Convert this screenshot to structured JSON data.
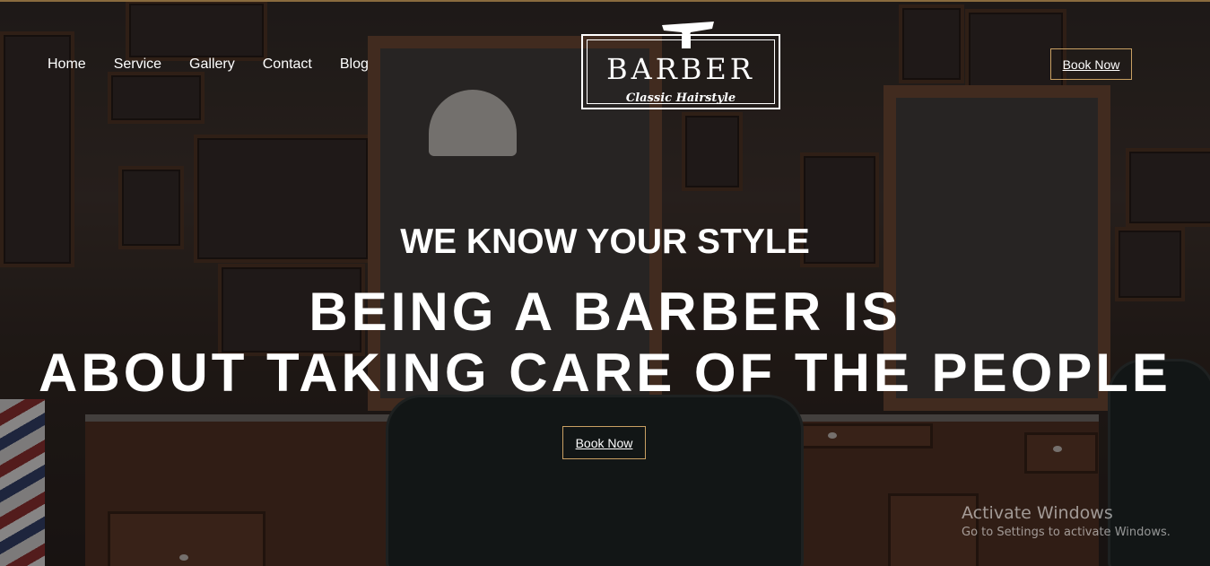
{
  "nav": {
    "items": [
      "Home",
      "Service",
      "Gallery",
      "Contact",
      "Blog"
    ],
    "book_label": "Book Now"
  },
  "logo": {
    "title": "BARBER",
    "subtitle": "Classic Hairstyle",
    "icon": "razor-icon"
  },
  "hero": {
    "tagline": "WE KNOW YOUR STYLE",
    "headline_line1": "BEING A BARBER IS",
    "headline_line2": "ABOUT TAKING CARE OF THE PEOPLE",
    "cta_label": "Book Now"
  },
  "watermark": {
    "title": "Activate Windows",
    "subtitle": "Go to Settings to activate Windows."
  },
  "colors": {
    "accent_border": "#c9a063",
    "text": "#ffffff"
  }
}
